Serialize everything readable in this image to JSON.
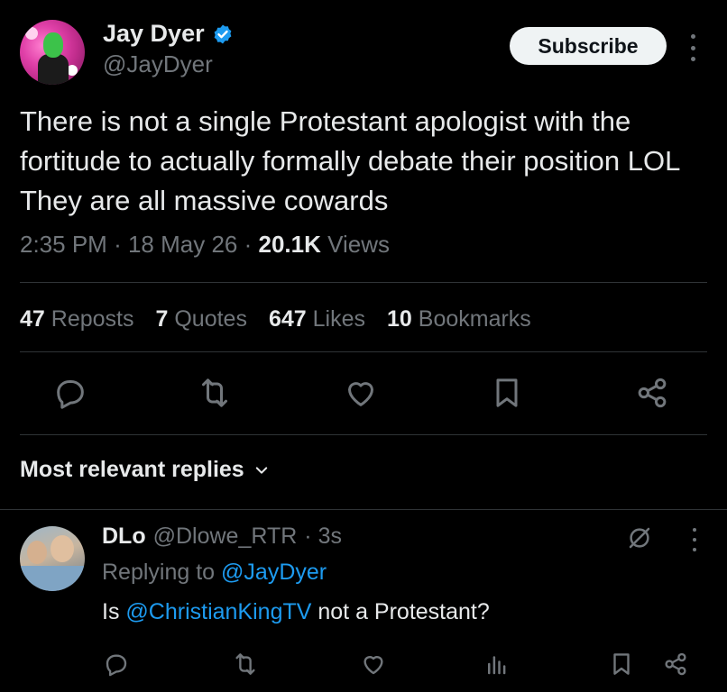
{
  "author": {
    "name": "Jay Dyer",
    "handle": "@JayDyer",
    "verified": true
  },
  "subscribe_label": "Subscribe",
  "tweet": {
    "text": "There is not a single Protestant apologist with the fortitude to actually formally debate their position LOL They are all massive cowards",
    "time": "2:35 PM",
    "date": "18 May 26",
    "views_count": "20.1K",
    "views_label": "Views",
    "sep": "·"
  },
  "stats": {
    "reposts_count": "47",
    "reposts_label": "Reposts",
    "quotes_count": "7",
    "quotes_label": "Quotes",
    "likes_count": "647",
    "likes_label": "Likes",
    "bookmarks_count": "10",
    "bookmarks_label": "Bookmarks"
  },
  "replies_filter_label": "Most relevant replies",
  "reply": {
    "name": "DLo",
    "handle": "@Dlowe_RTR",
    "time": "· 3s",
    "replying_prefix": "Replying to",
    "replying_handle": "@JayDyer",
    "text_prefix": "Is",
    "mention": "@ChristianKingTV",
    "text_suffix": "not a Protestant?"
  },
  "colors": {
    "background": "#000000",
    "text": "#e7e9ea",
    "muted": "#71767b",
    "accent": "#1d9bf0",
    "divider": "#2f3336"
  },
  "icons": [
    "verified-badge-icon",
    "more-icon",
    "reply-icon",
    "repost-icon",
    "like-icon",
    "bookmark-icon",
    "share-icon",
    "chevron-down-icon",
    "grok-icon",
    "views-icon"
  ]
}
